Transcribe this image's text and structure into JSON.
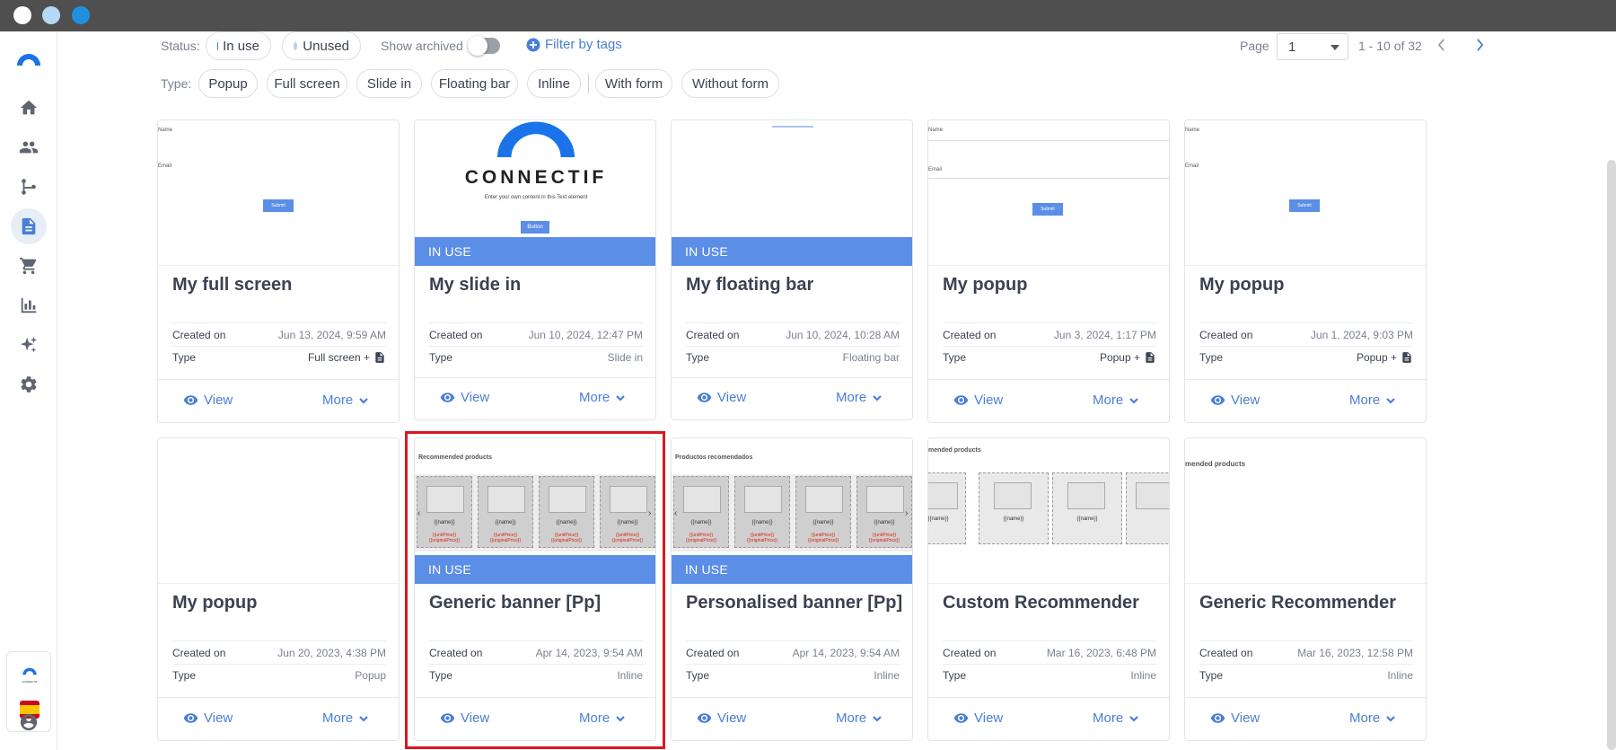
{
  "window": {
    "dots": [
      "#ffffff",
      "#b3d9f5",
      "#1e90e0"
    ]
  },
  "sidebar": {
    "items": [
      {
        "icon": "logo-icon"
      },
      {
        "icon": "home-icon"
      },
      {
        "icon": "contacts-icon"
      },
      {
        "icon": "workflow-icon"
      },
      {
        "icon": "content-icon",
        "active": true
      },
      {
        "icon": "cart-icon"
      },
      {
        "icon": "reports-icon"
      },
      {
        "icon": "ai-sparkle-icon"
      },
      {
        "icon": "settings-icon"
      }
    ],
    "bottom": {
      "brand": "CONNECTIF",
      "flag": "spain-flag-icon",
      "user": "user-icon"
    }
  },
  "filters": {
    "status_label": "Status:",
    "status_in_use": "In use",
    "status_unused": "Unused",
    "show_archived": "Show archived",
    "filter_tags": "Filter by tags",
    "type_label": "Type:",
    "types": [
      "Popup",
      "Full screen",
      "Slide in",
      "Floating bar",
      "Inline"
    ],
    "form_types": [
      "With form",
      "Without form"
    ]
  },
  "pagination": {
    "page_label": "Page",
    "page_value": "1",
    "range": "1 - 10 of 32"
  },
  "labels": {
    "created_on": "Created on",
    "type": "Type",
    "view": "View",
    "more": "More",
    "in_use": "IN USE"
  },
  "cards": [
    {
      "title": "My full screen",
      "created": "Jun 13, 2024, 9:59 AM",
      "type": "Full screen +",
      "type_icon": true,
      "in_use": false
    },
    {
      "title": "My slide in",
      "created": "Jun 10, 2024, 12:47 PM",
      "type": "Slide in",
      "type_icon": false,
      "in_use": true
    },
    {
      "title": "My floating bar",
      "created": "Jun 10, 2024, 10:28 AM",
      "type": "Floating bar",
      "type_icon": false,
      "in_use": true
    },
    {
      "title": "My popup",
      "created": "Jun 3, 2024, 1:17 PM",
      "type": "Popup +",
      "type_icon": true,
      "in_use": false
    },
    {
      "title": "My popup",
      "created": "Jun 1, 2024, 9:03 PM",
      "type": "Popup +",
      "type_icon": true,
      "in_use": false
    },
    {
      "title": "My popup",
      "created": "Jun 20, 2023, 4:38 PM",
      "type": "Popup",
      "type_icon": false,
      "in_use": false
    },
    {
      "title": "Generic banner [Pp]",
      "created": "Apr 14, 2023, 9:54 AM",
      "type": "Inline",
      "type_icon": false,
      "in_use": true
    },
    {
      "title": "Personalised banner [Pp]",
      "created": "Apr 14, 2023, 9:54 AM",
      "type": "Inline",
      "type_icon": false,
      "in_use": true
    },
    {
      "title": "Custom Recommender",
      "created": "Mar 16, 2023, 6:48 PM",
      "type": "Inline",
      "type_icon": false,
      "in_use": false
    },
    {
      "title": "Generic Recommender",
      "created": "Mar 16, 2023, 12:58 PM",
      "type": "Inline",
      "type_icon": false,
      "in_use": false
    }
  ],
  "thumbs": {
    "connectif_logo": "CONNECTIF",
    "connectif_sub": "Enter your own content in this Text element",
    "button": "Button",
    "submit": "Submit",
    "email": "Email",
    "name": "Name",
    "recommended_en": "Recommended products",
    "recommended_es": "Productos recomendados",
    "recommended_cut": "mended products",
    "product_name": "{{name}}",
    "product_price": "{{unitPrice}} {{originalPrice}}"
  },
  "colors": {
    "accent": "#4a7fd4",
    "in_use_bar": "#5b8ee6",
    "highlight": "#d7191f"
  }
}
